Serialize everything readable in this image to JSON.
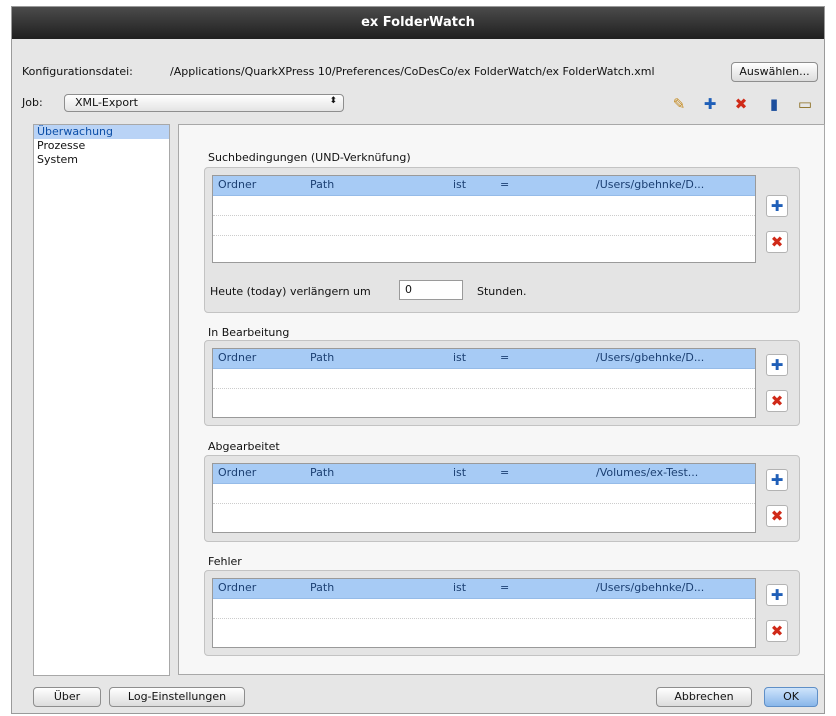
{
  "window": {
    "title": "ex FolderWatch"
  },
  "config": {
    "label": "Konfigurationsdatei:",
    "path": "/Applications/QuarkXPress 10/Preferences/CoDesCo/ex FolderWatch/ex FolderWatch.xml",
    "choose_button": "Auswählen..."
  },
  "job": {
    "label": "Job:",
    "selected": "XML-Export",
    "arrow": "⬍"
  },
  "toolbar": {
    "edit": "✎",
    "add": "✚",
    "delete": "✖",
    "copy": "▮",
    "folder": "▭"
  },
  "colors": {
    "accent": "#1f5fb8",
    "delete": "#d02a18",
    "selection": "#a7cbf5"
  },
  "sidebar": {
    "items": [
      {
        "label": "Überwachung",
        "selected": true
      },
      {
        "label": "Prozesse"
      },
      {
        "label": "System"
      }
    ]
  },
  "sections": {
    "search": {
      "title": "Suchbedingungen (UND-Verknüfung)",
      "row": [
        "Ordner",
        "Path",
        "ist",
        "=",
        "/Users/gbehnke/D..."
      ]
    },
    "extend": {
      "label": "Heute (today) verlängern um",
      "value": "0",
      "unit": "Stunden."
    },
    "processing": {
      "title": "In Bearbeitung",
      "row": [
        "Ordner",
        "Path",
        "ist",
        "=",
        "/Users/gbehnke/D..."
      ]
    },
    "done": {
      "title": "Abgearbeitet",
      "row": [
        "Ordner",
        "Path",
        "ist",
        "=",
        "/Volumes/ex-Test..."
      ]
    },
    "error": {
      "title": "Fehler",
      "row": [
        "Ordner",
        "Path",
        "ist",
        "=",
        "/Users/gbehnke/D..."
      ]
    }
  },
  "icons": {
    "plus": "✚",
    "delete": "✖"
  },
  "footer": {
    "about": "Über",
    "log": "Log-Einstellungen",
    "cancel": "Abbrechen",
    "ok": "OK"
  }
}
